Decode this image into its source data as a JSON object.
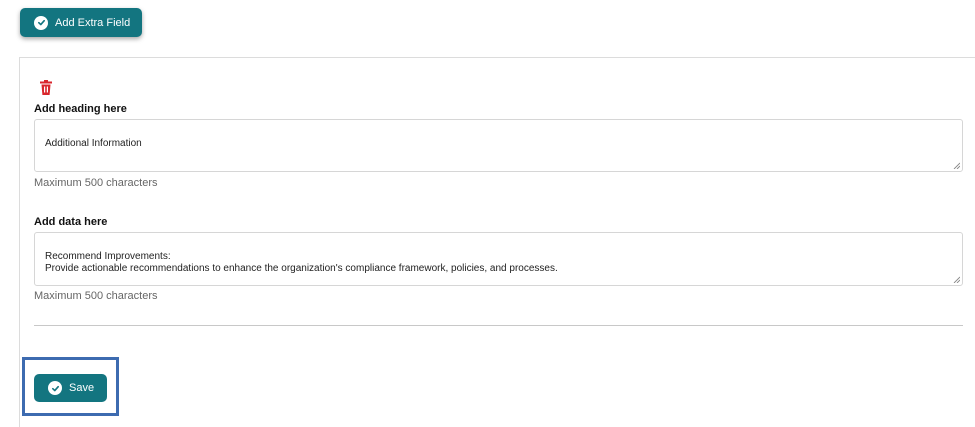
{
  "toolbar": {
    "add_extra_field_label": "Add Extra Field"
  },
  "form": {
    "heading_label": "Add heading here",
    "heading_value": "Additional Information",
    "heading_hint": "Maximum 500 characters",
    "data_label": "Add data here",
    "data_value": "Recommend Improvements:\nProvide actionable recommendations to enhance the organization's compliance framework, policies, and processes.",
    "data_hint": "Maximum 500 characters",
    "save_label": "Save"
  },
  "icons": {
    "check": "check-circle-icon",
    "delete": "trash-icon",
    "resize": "resize-grip-icon"
  },
  "colors": {
    "accent": "#137580",
    "danger": "#d9262c",
    "highlight": "#3d6bb0"
  }
}
